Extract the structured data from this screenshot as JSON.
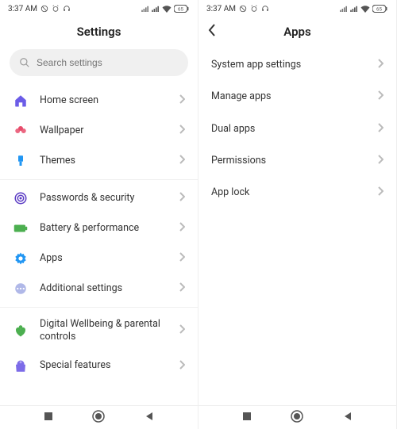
{
  "status": {
    "time": "3:37 AM",
    "battery": "65"
  },
  "left": {
    "title": "Settings",
    "search_placeholder": "Search settings",
    "groups": [
      [
        {
          "id": "home-screen",
          "label": "Home screen",
          "icon": "home",
          "color": "#6b5ce7"
        },
        {
          "id": "wallpaper",
          "label": "Wallpaper",
          "icon": "flower",
          "color": "#e74c6b"
        },
        {
          "id": "themes",
          "label": "Themes",
          "icon": "brush",
          "color": "#2196f3"
        }
      ],
      [
        {
          "id": "passwords-security",
          "label": "Passwords & security",
          "icon": "target",
          "color": "#5b3cc4"
        },
        {
          "id": "battery-performance",
          "label": "Battery & performance",
          "icon": "battery",
          "color": "#4caf50"
        },
        {
          "id": "apps",
          "label": "Apps",
          "icon": "gear",
          "color": "#2196f3"
        },
        {
          "id": "additional-settings",
          "label": "Additional settings",
          "icon": "dots",
          "color": "#b0b8e8"
        }
      ],
      [
        {
          "id": "digital-wellbeing",
          "label": "Digital Wellbeing & parental controls",
          "icon": "heart",
          "color": "#4caf50"
        },
        {
          "id": "special-features",
          "label": "Special features",
          "icon": "bag",
          "color": "#7c6be8"
        }
      ]
    ]
  },
  "right": {
    "title": "Apps",
    "items": [
      {
        "id": "system-app-settings",
        "label": "System app settings"
      },
      {
        "id": "manage-apps",
        "label": "Manage apps"
      },
      {
        "id": "dual-apps",
        "label": "Dual apps"
      },
      {
        "id": "permissions",
        "label": "Permissions"
      },
      {
        "id": "app-lock",
        "label": "App lock"
      }
    ]
  }
}
